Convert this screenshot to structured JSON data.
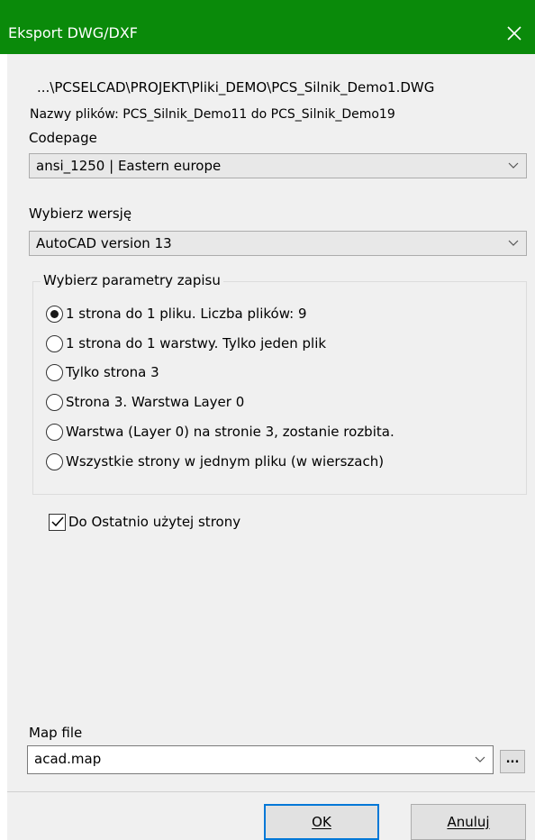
{
  "window": {
    "title": "Eksport DWG/DXF"
  },
  "info": {
    "path": "...\\PCSELCAD\\PROJEKT\\Pliki_DEMO\\PCS_Silnik_Demo1.DWG",
    "file_names": "Nazwy plików: PCS_Silnik_Demo11 do PCS_Silnik_Demo19"
  },
  "codepage": {
    "label": "Codepage",
    "value": "ansi_1250 | Eastern europe"
  },
  "version": {
    "label": "Wybierz wersję",
    "value": "AutoCAD version 13"
  },
  "save_params": {
    "title": "Wybierz parametry zapisu",
    "options": [
      {
        "label": "1 strona do 1 pliku. Liczba plików: 9",
        "checked": true
      },
      {
        "label": "1 strona do 1 warstwy. Tylko jeden plik",
        "checked": false
      },
      {
        "label": "Tylko strona 3",
        "checked": false
      },
      {
        "label": "Strona 3. Warstwa Layer 0",
        "checked": false
      },
      {
        "label": "Warstwa (Layer 0) na stronie 3, zostanie rozbita.",
        "checked": false
      },
      {
        "label": "Wszystkie strony w jednym pliku (w wierszach)",
        "checked": false
      }
    ]
  },
  "last_page": {
    "label": "Do Ostatnio użytej strony",
    "checked": true
  },
  "map_file": {
    "label": "Map file",
    "value": "acad.map",
    "browse_label": "..."
  },
  "buttons": {
    "ok": "OK",
    "cancel": "Anuluj"
  },
  "colors": {
    "titlebar": "#0a8a0a",
    "dialog_bg": "#f0f0f0",
    "default_button_border": "#0078d7"
  }
}
